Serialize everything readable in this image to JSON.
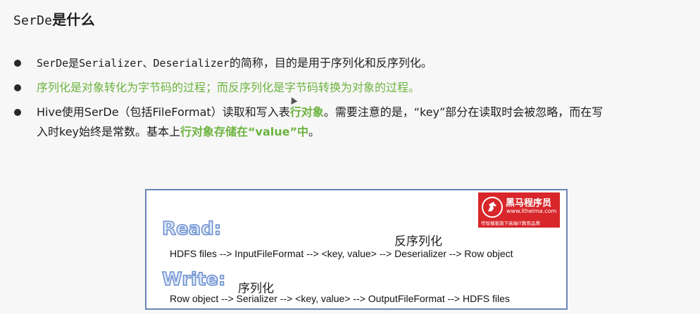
{
  "title": {
    "code": "SerDe",
    "text": "是什么"
  },
  "bullets": {
    "b1": {
      "part1": "SerDe是Serializer、Deserializer",
      "part2": "的简称，目的是用于序列化和反序列化。"
    },
    "b2": {
      "part1": "序列化是对象转化为字节码的过程；而",
      "part2": "反序列化是字节码转换为对象的过程。"
    },
    "b3": {
      "part1": "Hive使用SerDe（包括FileFormat）读取和写入表",
      "part2": "行对象",
      "part3": "。需要注意的是，“key”部分在读取时会被忽略，而在写",
      "part4": "入时key始终是常数。基本上",
      "part5": "行对象存储在“value”中",
      "part6": "。"
    }
  },
  "diagram": {
    "read_label": "Read:",
    "write_label": "Write:",
    "read_cn": "反序列化",
    "write_cn": "序列化",
    "read_flow": "HDFS files --> InputFileFormat --> <key, value> --> Deserializer --> Row object",
    "write_flow": "Row object --> Serializer --> <key, value> --> OutputFileFormat --> HDFS files",
    "logo": {
      "name": "黑马程序员",
      "url": "www.itheima.com",
      "slogan": "传智播客旗下高端IT教育品牌"
    }
  },
  "colors": {
    "highlight_green": "#6cb33e",
    "logo_red": "#d8262b",
    "diagram_border": "#6a84b8"
  }
}
